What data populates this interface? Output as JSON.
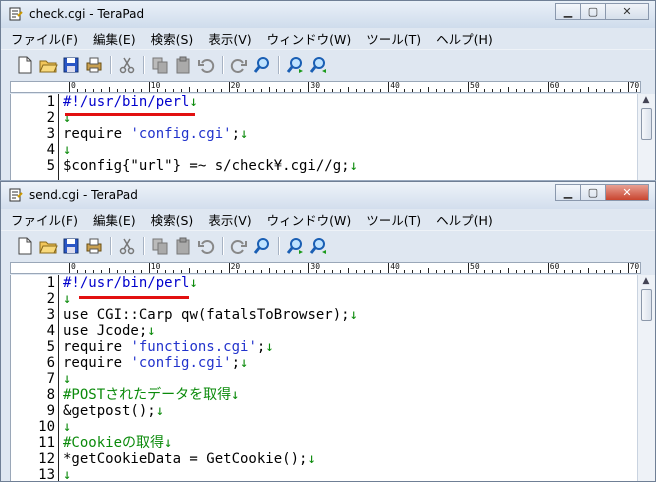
{
  "back_window": {
    "title": "check.cgi - TeraPad",
    "menu": [
      "ファイル(F)",
      "編集(E)",
      "検索(S)",
      "表示(V)",
      "ウィンドウ(W)",
      "ツール(T)",
      "ヘルプ(H)"
    ],
    "ruler_labels": [
      "0",
      "10",
      "20",
      "30",
      "40",
      "50",
      "60",
      "70"
    ],
    "line_numbers": [
      "1",
      "2",
      "3",
      "4",
      "5"
    ],
    "code": [
      {
        "parts": [
          {
            "t": "#!/usr/bin/perl",
            "c": "cr"
          },
          {
            "t": "↓",
            "c": "ret"
          }
        ]
      },
      {
        "parts": [
          {
            "t": "↓",
            "c": "ret"
          }
        ]
      },
      {
        "parts": [
          {
            "t": "require ",
            "c": "kw"
          },
          {
            "t": "'config.cgi'",
            "c": "str"
          },
          {
            "t": ";",
            "c": "kw"
          },
          {
            "t": "↓",
            "c": "ret"
          }
        ]
      },
      {
        "parts": [
          {
            "t": "↓",
            "c": "ret"
          }
        ]
      },
      {
        "parts": [
          {
            "t": "$config{\"url\"} =~ s/check¥.cgi//g;",
            "c": "kw"
          },
          {
            "t": "↓",
            "c": "ret"
          }
        ]
      }
    ]
  },
  "front_window": {
    "title": "send.cgi - TeraPad",
    "menu": [
      "ファイル(F)",
      "編集(E)",
      "検索(S)",
      "表示(V)",
      "ウィンドウ(W)",
      "ツール(T)",
      "ヘルプ(H)"
    ],
    "ruler_labels": [
      "0",
      "10",
      "20",
      "30",
      "40",
      "50",
      "60",
      "70"
    ],
    "line_numbers": [
      "1",
      "2",
      "3",
      "4",
      "5",
      "6",
      "7",
      "8",
      "9",
      "10",
      "11",
      "12",
      "13"
    ],
    "code": [
      {
        "parts": [
          {
            "t": "#!/usr/bin/perl",
            "c": "cr"
          },
          {
            "t": "↓",
            "c": "ret"
          }
        ]
      },
      {
        "parts": [
          {
            "t": "↓",
            "c": "ret"
          }
        ]
      },
      {
        "parts": [
          {
            "t": "use CGI::Carp ",
            "c": "kw"
          },
          {
            "t": "qw",
            "c": "kw"
          },
          {
            "t": "(fatalsToBrowser);",
            "c": "kw"
          },
          {
            "t": "↓",
            "c": "ret"
          }
        ]
      },
      {
        "parts": [
          {
            "t": "use Jcode;",
            "c": "kw"
          },
          {
            "t": "↓",
            "c": "ret"
          }
        ]
      },
      {
        "parts": [
          {
            "t": "require ",
            "c": "kw"
          },
          {
            "t": "'functions.cgi'",
            "c": "str"
          },
          {
            "t": ";",
            "c": "kw"
          },
          {
            "t": "↓",
            "c": "ret"
          }
        ]
      },
      {
        "parts": [
          {
            "t": "require ",
            "c": "kw"
          },
          {
            "t": "'config.cgi'",
            "c": "str"
          },
          {
            "t": ";",
            "c": "kw"
          },
          {
            "t": "↓",
            "c": "ret"
          }
        ]
      },
      {
        "parts": [
          {
            "t": "↓",
            "c": "ret"
          }
        ]
      },
      {
        "parts": [
          {
            "t": "#POSTされたデータを取得",
            "c": "comment"
          },
          {
            "t": "↓",
            "c": "ret"
          }
        ]
      },
      {
        "parts": [
          {
            "t": "&getpost();",
            "c": "kw"
          },
          {
            "t": "↓",
            "c": "ret"
          }
        ]
      },
      {
        "parts": [
          {
            "t": "↓",
            "c": "ret"
          }
        ]
      },
      {
        "parts": [
          {
            "t": "#Cookieの取得",
            "c": "comment"
          },
          {
            "t": "↓",
            "c": "ret"
          }
        ]
      },
      {
        "parts": [
          {
            "t": "*getCookieData = GetCookie();",
            "c": "kw"
          },
          {
            "t": "↓",
            "c": "ret"
          }
        ]
      },
      {
        "parts": [
          {
            "t": "↓",
            "c": "ret"
          }
        ]
      }
    ]
  },
  "toolbar_icons": [
    "new-file-icon",
    "open-folder-icon",
    "save-icon",
    "print-icon",
    "cut-icon",
    "copy-icon",
    "paste-icon",
    "undo-icon",
    "redo-icon",
    "find-icon",
    "find-next-icon",
    "find-prev-icon"
  ],
  "colors": {
    "highlight": "#e21010",
    "return_mark": "#0a8a0a",
    "string": "#2233cc"
  }
}
